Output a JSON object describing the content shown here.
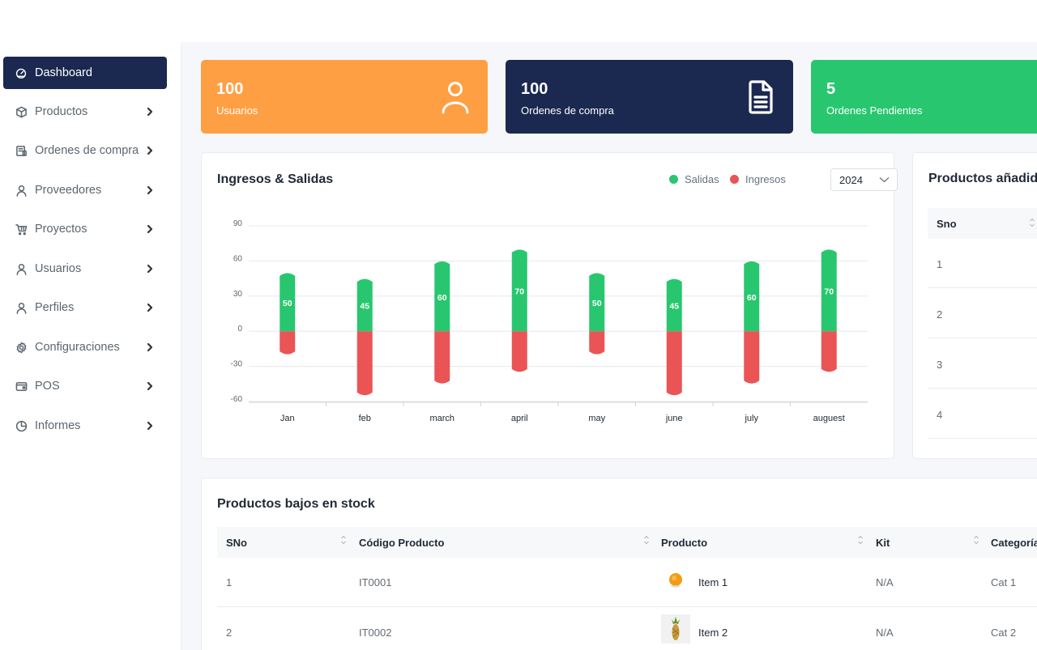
{
  "sidebar": {
    "items": [
      {
        "label": "Dashboard",
        "icon": "dashboard-icon"
      },
      {
        "label": "Productos",
        "icon": "box-icon"
      },
      {
        "label": "Ordenes de compra",
        "icon": "purchase-order-icon"
      },
      {
        "label": "Proveedores",
        "icon": "user-icon"
      },
      {
        "label": "Proyectos",
        "icon": "cart-icon"
      },
      {
        "label": "Usuarios",
        "icon": "user-icon"
      },
      {
        "label": "Perfiles",
        "icon": "user-icon"
      },
      {
        "label": "Configuraciones",
        "icon": "gear-icon"
      },
      {
        "label": "POS",
        "icon": "pos-icon"
      },
      {
        "label": "Informes",
        "icon": "pie-chart-icon"
      }
    ]
  },
  "cards": [
    {
      "value": "100",
      "label": "Usuarios",
      "color": "#ff9f43",
      "icon": "user-icon"
    },
    {
      "value": "100",
      "label": "Ordenes de compra",
      "color": "#1b2850",
      "icon": "document-icon"
    },
    {
      "value": "5",
      "label": "Ordenes Pendientes",
      "color": "#28c76f",
      "icon": "pending-icon"
    }
  ],
  "chart_panel": {
    "title": "Ingresos & Salidas",
    "year": "2024",
    "legend_salidas": "Salidas",
    "legend_ingresos": "Ingresos"
  },
  "chart_data": {
    "type": "bar",
    "title": "Ingresos & Salidas",
    "categories": [
      "Jan",
      "feb",
      "march",
      "april",
      "may",
      "june",
      "july",
      "auguest"
    ],
    "series": [
      {
        "name": "Salidas",
        "color": "#28c76f",
        "values": [
          50,
          45,
          60,
          70,
          50,
          45,
          60,
          70
        ]
      },
      {
        "name": "Ingresos",
        "color": "#ea5455",
        "values": [
          -20,
          -55,
          -45,
          -35,
          -20,
          -55,
          -45,
          -35
        ]
      }
    ],
    "yticks": [
      90,
      60,
      30,
      0,
      -30,
      -60
    ],
    "ylim": [
      -60,
      90
    ],
    "grid": true,
    "legend": "top-right"
  },
  "recent_panel": {
    "title": "Productos añadidos recientemente",
    "header_sno": "Sno",
    "rows": [
      "1",
      "2",
      "3",
      "4"
    ]
  },
  "stock_panel": {
    "title": "Productos bajos en stock",
    "headers": {
      "sno": "SNo",
      "codigo": "Código Producto",
      "producto": "Producto",
      "kit": "Kit",
      "categoria": "Categoría"
    },
    "rows": [
      {
        "sno": "1",
        "codigo": "IT0001",
        "producto": "Item 1",
        "kit": "N/A",
        "categoria": "Cat 1",
        "thumb": "orange-image"
      },
      {
        "sno": "2",
        "codigo": "IT0002",
        "producto": "Item 2",
        "kit": "N/A",
        "categoria": "Cat 2",
        "thumb": "pineapple-image"
      }
    ]
  }
}
